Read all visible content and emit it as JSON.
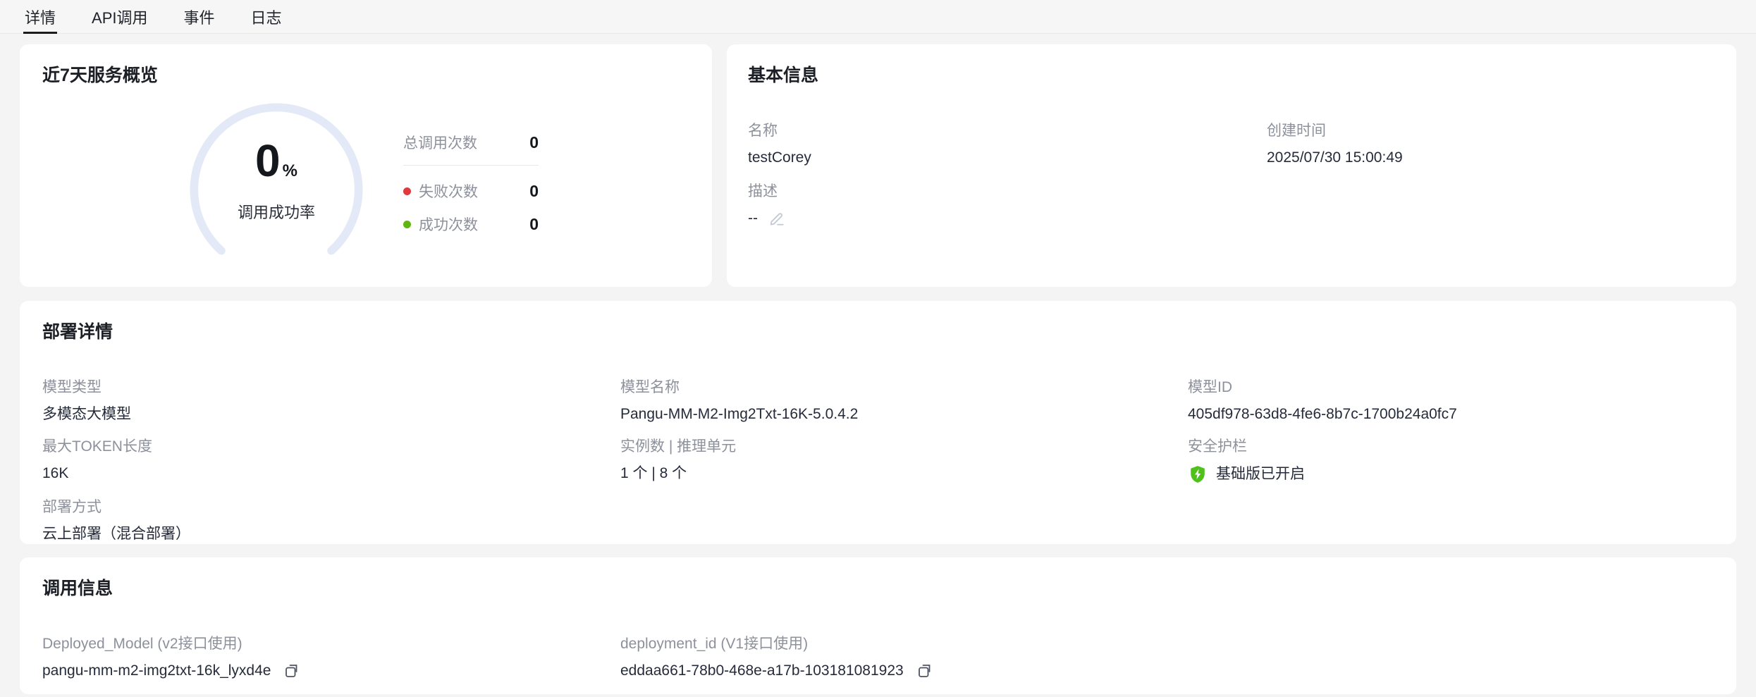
{
  "tabs": [
    {
      "label": "详情",
      "active": true
    },
    {
      "label": "API调用",
      "active": false
    },
    {
      "label": "事件",
      "active": false
    },
    {
      "label": "日志",
      "active": false
    }
  ],
  "overview": {
    "title": "近7天服务概览",
    "gauge": {
      "value": "0",
      "unit": "%",
      "caption": "调用成功率"
    },
    "stats": {
      "total": {
        "label": "总调用次数",
        "value": "0"
      },
      "failed": {
        "label": "失败次数",
        "value": "0"
      },
      "success": {
        "label": "成功次数",
        "value": "0"
      }
    }
  },
  "basic_info": {
    "title": "基本信息",
    "name": {
      "label": "名称",
      "value": "testCorey"
    },
    "created": {
      "label": "创建时间",
      "value": "2025/07/30 15:00:49"
    },
    "description": {
      "label": "描述",
      "value": "--"
    }
  },
  "deployment": {
    "title": "部署详情",
    "model_type": {
      "label": "模型类型",
      "value": "多模态大模型"
    },
    "model_name": {
      "label": "模型名称",
      "value": "Pangu-MM-M2-Img2Txt-16K-5.0.4.2"
    },
    "model_id": {
      "label": "模型ID",
      "value": "405df978-63d8-4fe6-8b7c-1700b24a0fc7"
    },
    "max_token": {
      "label": "最大TOKEN长度",
      "value": "16K"
    },
    "instances": {
      "label": "实例数 | 推理单元",
      "value": "1 个 | 8 个"
    },
    "guardrail": {
      "label": "安全护栏",
      "value": "基础版已开启"
    },
    "deploy_mode": {
      "label": "部署方式",
      "value": "云上部署（混合部署）"
    }
  },
  "invocation": {
    "title": "调用信息",
    "deployed_model": {
      "label": "Deployed_Model (v2接口使用)",
      "value": "pangu-mm-m2-img2txt-16k_lyxd4e"
    },
    "deployment_id": {
      "label": "deployment_id (V1接口使用)",
      "value": "eddaa661-78b0-468e-a17b-103181081923"
    }
  },
  "icons": {
    "edit": "edit-pencil-icon",
    "copy": "copy-icon",
    "guardrail": "shield-bolt-icon"
  },
  "colors": {
    "page_bg": "#f4f4f5",
    "card_bg": "#ffffff",
    "active_tab_underline": "#1c1c1c",
    "gauge_arc": "#e4e9f7",
    "failed_dot": "#e2393b",
    "success_dot": "#60b510",
    "guardrail_shield": "#4fc11a",
    "label_gray": "#8d919c",
    "text_dark": "#252b3a"
  }
}
